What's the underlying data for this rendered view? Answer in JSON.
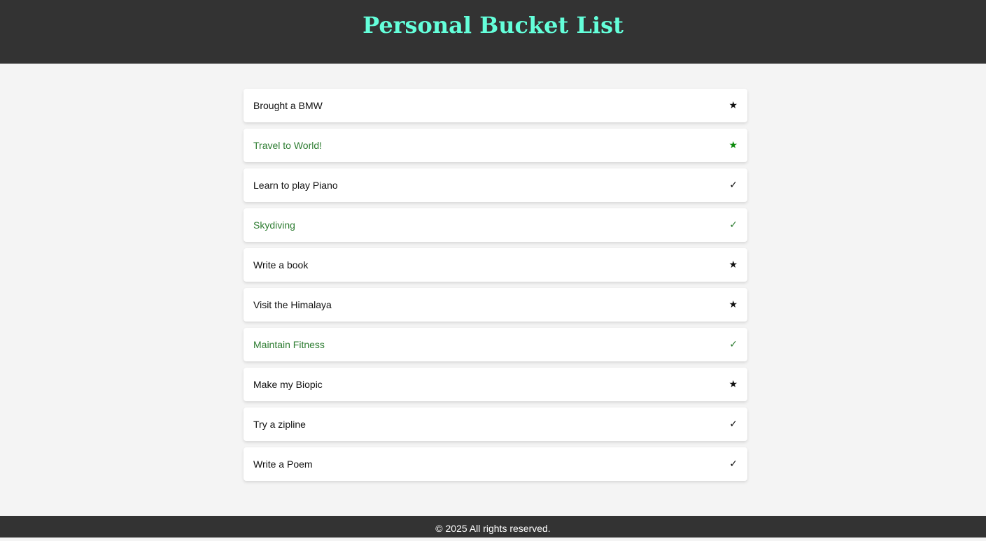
{
  "header": {
    "title": "Personal Bucket List",
    "title_color": "#64ffda",
    "background": "#333333"
  },
  "items": [
    {
      "label": "Brought a BMW",
      "icon": "star-icon",
      "glyph": "★",
      "highlighted": false
    },
    {
      "label": "Travel to World!",
      "icon": "star-icon",
      "glyph": "★",
      "highlighted": true
    },
    {
      "label": "Learn to play Piano",
      "icon": "check-icon",
      "glyph": "✓",
      "highlighted": false
    },
    {
      "label": "Skydiving",
      "icon": "check-icon",
      "glyph": "✓",
      "highlighted": true
    },
    {
      "label": "Write a book",
      "icon": "star-icon",
      "glyph": "★",
      "highlighted": false
    },
    {
      "label": "Visit the Himalaya",
      "icon": "star-icon",
      "glyph": "★",
      "highlighted": false
    },
    {
      "label": "Maintain Fitness",
      "icon": "check-icon",
      "glyph": "✓",
      "highlighted": true
    },
    {
      "label": "Make my Biopic",
      "icon": "star-icon",
      "glyph": "★",
      "highlighted": false
    },
    {
      "label": "Try a zipline",
      "icon": "check-icon",
      "glyph": "✓",
      "highlighted": false
    },
    {
      "label": "Write a Poem",
      "icon": "check-icon",
      "glyph": "✓",
      "highlighted": false
    }
  ],
  "colors": {
    "normal_text": "#111111",
    "highlight_text": "#2e7d32",
    "highlight_star": "#0a8a0a"
  },
  "footer": {
    "text": "© 2025 All rights reserved."
  }
}
